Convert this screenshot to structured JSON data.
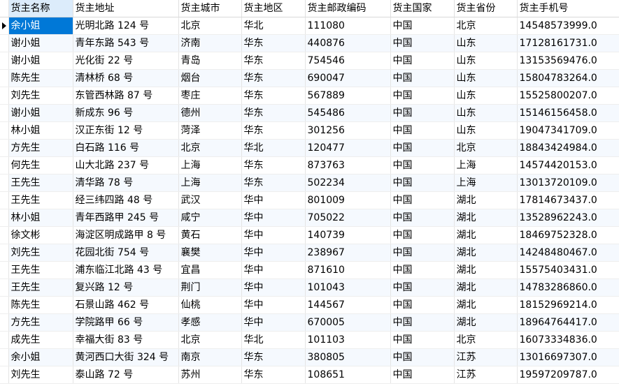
{
  "table": {
    "columns": [
      "货主名称",
      "货主地址",
      "货主城市",
      "货主地区",
      "货主邮政编码",
      "货主国家",
      "货主省份",
      "货主手机号"
    ],
    "rows": [
      [
        "余小姐",
        "光明北路 124 号",
        "北京",
        "华北",
        "111080",
        "中国",
        "北京",
        "14548573999.0"
      ],
      [
        "谢小姐",
        "青年东路 543 号",
        "济南",
        "华东",
        "440876",
        "中国",
        "山东",
        "17128161731.0"
      ],
      [
        "谢小姐",
        "光化街 22 号",
        "青岛",
        "华东",
        "754546",
        "中国",
        "山东",
        "13153569476.0"
      ],
      [
        "陈先生",
        "清林桥 68 号",
        "烟台",
        "华东",
        "690047",
        "中国",
        "山东",
        "15804783264.0"
      ],
      [
        "刘先生",
        "东管西林路 87 号",
        "枣庄",
        "华东",
        "567889",
        "中国",
        "山东",
        "15525800207.0"
      ],
      [
        "谢小姐",
        "新成东 96 号",
        "德州",
        "华东",
        "545486",
        "中国",
        "山东",
        "15146156458.0"
      ],
      [
        "林小姐",
        "汉正东街 12 号",
        "菏泽",
        "华东",
        "301256",
        "中国",
        "山东",
        "19047341709.0"
      ],
      [
        "方先生",
        "白石路 116 号",
        "北京",
        "华北",
        "120477",
        "中国",
        "北京",
        "18843424984.0"
      ],
      [
        "何先生",
        "山大北路 237 号",
        "上海",
        "华东",
        "873763",
        "中国",
        "上海",
        "14574420153.0"
      ],
      [
        "王先生",
        "清华路 78 号",
        "上海",
        "华东",
        "502234",
        "中国",
        "上海",
        "13013720109.0"
      ],
      [
        "王先生",
        "经三纬四路 48 号",
        "武汉",
        "华中",
        "801009",
        "中国",
        "湖北",
        "17814673437.0"
      ],
      [
        "林小姐",
        "青年西路甲 245 号",
        "咸宁",
        "华中",
        "705022",
        "中国",
        "湖北",
        "13528962243.0"
      ],
      [
        "徐文彬",
        "海淀区明成路甲 8 号",
        "黄石",
        "华中",
        "140739",
        "中国",
        "湖北",
        "18469752328.0"
      ],
      [
        "刘先生",
        "花园北街 754 号",
        "襄樊",
        "华中",
        "238967",
        "中国",
        "湖北",
        "14248480467.0"
      ],
      [
        "王先生",
        "浦东临江北路 43 号",
        "宜昌",
        "华中",
        "871610",
        "中国",
        "湖北",
        "15575403431.0"
      ],
      [
        "王先生",
        "复兴路 12 号",
        "荆门",
        "华中",
        "101043",
        "中国",
        "湖北",
        "14783286860.0"
      ],
      [
        "陈先生",
        "石景山路 462 号",
        "仙桃",
        "华中",
        "144567",
        "中国",
        "湖北",
        "18152969214.0"
      ],
      [
        "方先生",
        "学院路甲 66 号",
        "孝感",
        "华中",
        "670005",
        "中国",
        "湖北",
        "18964764417.0"
      ],
      [
        "成先生",
        "幸福大街 83 号",
        "北京",
        "华北",
        "101103",
        "中国",
        "北京",
        "16073334836.0"
      ],
      [
        "余小姐",
        "黄河西口大街 324 号",
        "南京",
        "华东",
        "380805",
        "中国",
        "江苏",
        "13016697307.0"
      ],
      [
        "刘先生",
        "泰山路 72 号",
        "苏州",
        "华东",
        "108651",
        "中国",
        "江苏",
        "19597209787.0"
      ]
    ]
  },
  "state": {
    "current_row": 0,
    "selected_column": 0
  },
  "colors": {
    "selection": "#0078d7",
    "header_active": "#dcecfb",
    "alt_row": "#f5f9fe"
  }
}
